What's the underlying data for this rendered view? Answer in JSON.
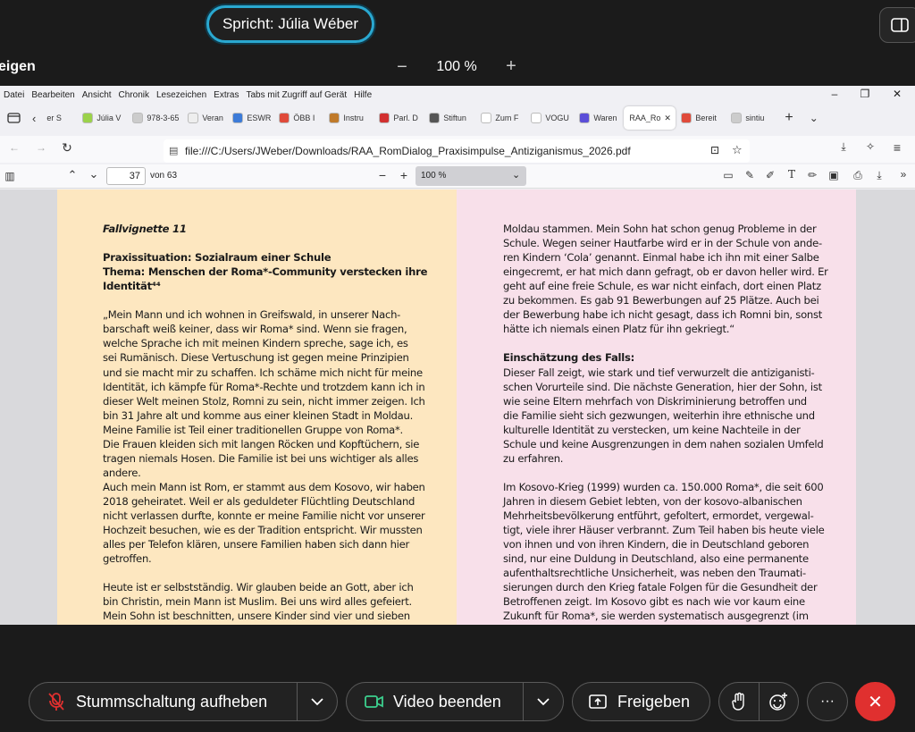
{
  "meeting": {
    "speaker": "Spricht: Júlia Wéber",
    "share_title": "eigen",
    "zoom": "100 %",
    "zoom_out": "−",
    "zoom_in": "+"
  },
  "browser": {
    "menu": [
      "Datei",
      "Bearbeiten",
      "Ansicht",
      "Chronik",
      "Lesezeichen",
      "Extras",
      "Tabs mit Zugriff auf Gerät",
      "Hilfe"
    ],
    "window_controls": [
      "–",
      "❐",
      "✕"
    ],
    "tabs": [
      {
        "label": "er S",
        "color": "#ffffff"
      },
      {
        "label": "Júlia V",
        "color": "#9bd24a"
      },
      {
        "label": "978-3-65",
        "color": "#cccccc"
      },
      {
        "label": "Veran",
        "color": "#eeeeee"
      },
      {
        "label": "ESWR",
        "color": "#3d7bd8"
      },
      {
        "label": "ÖBB I",
        "color": "#e04a3a"
      },
      {
        "label": "Instru",
        "color": "#c07a2a"
      },
      {
        "label": "Parl. D",
        "color": "#d23030"
      },
      {
        "label": "Stiftun",
        "color": "#555555"
      },
      {
        "label": "Zum F",
        "color": "#ffffff"
      },
      {
        "label": "VOGU",
        "color": "#ffffff"
      },
      {
        "label": "Waren",
        "color": "#5b4ed8"
      },
      {
        "label": "RAA_Ro",
        "color": "#ffffff"
      },
      {
        "label": "Bereit",
        "color": "#e04a3a"
      },
      {
        "label": "sintiu",
        "color": "#cccccc"
      }
    ],
    "active_tab_close": "✕",
    "new_tab": "+",
    "url": "file:///C:/Users/JWeber/Downloads/RAA_RomDialog_Praxisimpulse_Antiziganismus_2026.pdf"
  },
  "pdf": {
    "page_number": "37",
    "page_total": "von 63",
    "zoom": "100 %"
  },
  "left_page": [
    {
      "t": "Fallvignette 11",
      "s": "bi"
    },
    {
      "t": "",
      "s": ""
    },
    {
      "t": "Praxissituation: Sozialraum einer Schule",
      "s": "b"
    },
    {
      "t": "Thema: Menschen der Roma*-Community verstecken ihre",
      "s": "b"
    },
    {
      "t": "Identität⁴⁴",
      "s": "b"
    },
    {
      "t": "",
      "s": ""
    },
    {
      "t": "„Mein Mann und ich wohnen in Greifswald, in unserer Nach-",
      "s": ""
    },
    {
      "t": "barschaft weiß keiner, dass wir Roma* sind. Wenn sie fragen,",
      "s": ""
    },
    {
      "t": "welche Sprache ich mit meinen Kindern spreche, sage ich, es",
      "s": ""
    },
    {
      "t": "sei Rumänisch. Diese Vertuschung ist gegen meine Prinzipien",
      "s": ""
    },
    {
      "t": "und sie macht mir zu schaffen. Ich schäme mich nicht für meine",
      "s": ""
    },
    {
      "t": "Identität, ich kämpfe für Roma*-Rechte und trotzdem kann ich in",
      "s": ""
    },
    {
      "t": "dieser Welt meinen Stolz, Romni zu sein, nicht immer zeigen. Ich",
      "s": ""
    },
    {
      "t": "bin 31 Jahre alt und komme aus einer kleinen Stadt in Moldau.",
      "s": ""
    },
    {
      "t": "Meine Familie ist Teil einer traditionellen Gruppe von Roma*.",
      "s": ""
    },
    {
      "t": "Die Frauen kleiden sich mit langen Röcken und Kopftüchern, sie",
      "s": ""
    },
    {
      "t": "tragen niemals Hosen. Die Familie ist bei uns wichtiger als alles",
      "s": ""
    },
    {
      "t": "andere.",
      "s": ""
    },
    {
      "t": "Auch mein Mann ist Rom, er stammt aus dem Kosovo, wir haben",
      "s": ""
    },
    {
      "t": "2018 geheiratet. Weil er als geduldeter Flüchtling Deutschland",
      "s": ""
    },
    {
      "t": "nicht verlassen durfte, konnte er meine Familie nicht vor unserer",
      "s": ""
    },
    {
      "t": "Hochzeit besuchen, wie es der Tradition entspricht. Wir mussten",
      "s": ""
    },
    {
      "t": "alles per Telefon klären, unsere Familien haben sich dann hier",
      "s": ""
    },
    {
      "t": "getroffen.",
      "s": ""
    },
    {
      "t": "",
      "s": ""
    },
    {
      "t": "Heute ist er selbstständig. Wir glauben beide an Gott, aber ich",
      "s": ""
    },
    {
      "t": "bin Christin, mein Mann ist Muslim. Bei uns wird alles gefeiert.",
      "s": ""
    },
    {
      "t": "Mein Sohn ist beschnitten, unsere Kinder sind vier und sieben",
      "s": ""
    }
  ],
  "right_page": [
    {
      "t": "Moldau stammen. Mein Sohn hat schon genug Probleme in der",
      "s": ""
    },
    {
      "t": "Schule. Wegen seiner Hautfarbe wird er in der Schule von ande-",
      "s": ""
    },
    {
      "t": "ren Kindern ‘Cola’ genannt. Einmal habe ich ihn mit einer Salbe",
      "s": ""
    },
    {
      "t": "eingecremt, er hat mich dann gefragt, ob er davon heller wird. Er",
      "s": ""
    },
    {
      "t": "geht auf eine freie Schule, es war nicht einfach, dort einen Platz",
      "s": ""
    },
    {
      "t": "zu bekommen. Es gab 91 Bewerbungen auf 25 Plätze. Auch bei",
      "s": ""
    },
    {
      "t": "der Bewerbung habe ich nicht gesagt, dass ich Romni bin, sonst",
      "s": ""
    },
    {
      "t": "hätte ich niemals einen Platz für ihn gekriegt.“",
      "s": ""
    },
    {
      "t": "",
      "s": ""
    },
    {
      "t": "Einschätzung des Falls:",
      "s": "b"
    },
    {
      "t": "Dieser Fall zeigt, wie stark und tief verwurzelt die antiziganisti-",
      "s": ""
    },
    {
      "t": "schen Vorurteile sind. Die nächste Generation, hier der Sohn, ist",
      "s": ""
    },
    {
      "t": "wie seine Eltern mehrfach von Diskriminierung betroffen und",
      "s": ""
    },
    {
      "t": "die Familie sieht sich gezwungen, weiterhin ihre ethnische und",
      "s": ""
    },
    {
      "t": "kulturelle Identität zu verstecken, um keine Nachteile in der",
      "s": ""
    },
    {
      "t": "Schule und keine Ausgrenzungen in dem nahen sozialen Umfeld",
      "s": ""
    },
    {
      "t": "zu erfahren.",
      "s": ""
    },
    {
      "t": "",
      "s": ""
    },
    {
      "t": "Im Kosovo-Krieg (1999) wurden ca. 150.000 Roma*, die seit 600",
      "s": ""
    },
    {
      "t": "Jahren in diesem Gebiet lebten, von der kosovo-albanischen",
      "s": ""
    },
    {
      "t": "Mehrheitsbevölkerung entführt, gefoltert, ermordet, vergewal-",
      "s": ""
    },
    {
      "t": "tigt, viele ihrer Häuser verbrannt. Zum Teil haben bis heute viele",
      "s": ""
    },
    {
      "t": "von ihnen und von ihren Kindern, die in Deutschland geboren",
      "s": ""
    },
    {
      "t": "sind, nur eine Duldung in Deutschland, also eine permanente",
      "s": ""
    },
    {
      "t": "aufenthaltsrechtliche Unsicherheit, was neben den Traumati-",
      "s": ""
    },
    {
      "t": "sierungen durch den Krieg fatale Folgen für die Gesundheit der",
      "s": ""
    },
    {
      "t": "Betroffenen zeigt. Im Kosovo gibt es nach wie vor kaum eine",
      "s": ""
    },
    {
      "t": "Zukunft für Roma*, sie werden systematisch ausgegrenzt (im",
      "s": ""
    }
  ],
  "controls": {
    "unmute": "Stummschaltung aufheben",
    "video": "Video beenden",
    "share": "Freigeben",
    "more": "···",
    "leave": "✕"
  },
  "colors": {
    "accent_ring": "#2aa8d0",
    "leave_red": "#e0302f",
    "page_left": "#fde7c0",
    "page_right": "#f8e0ea",
    "video_icon": "#3ccf8e"
  }
}
